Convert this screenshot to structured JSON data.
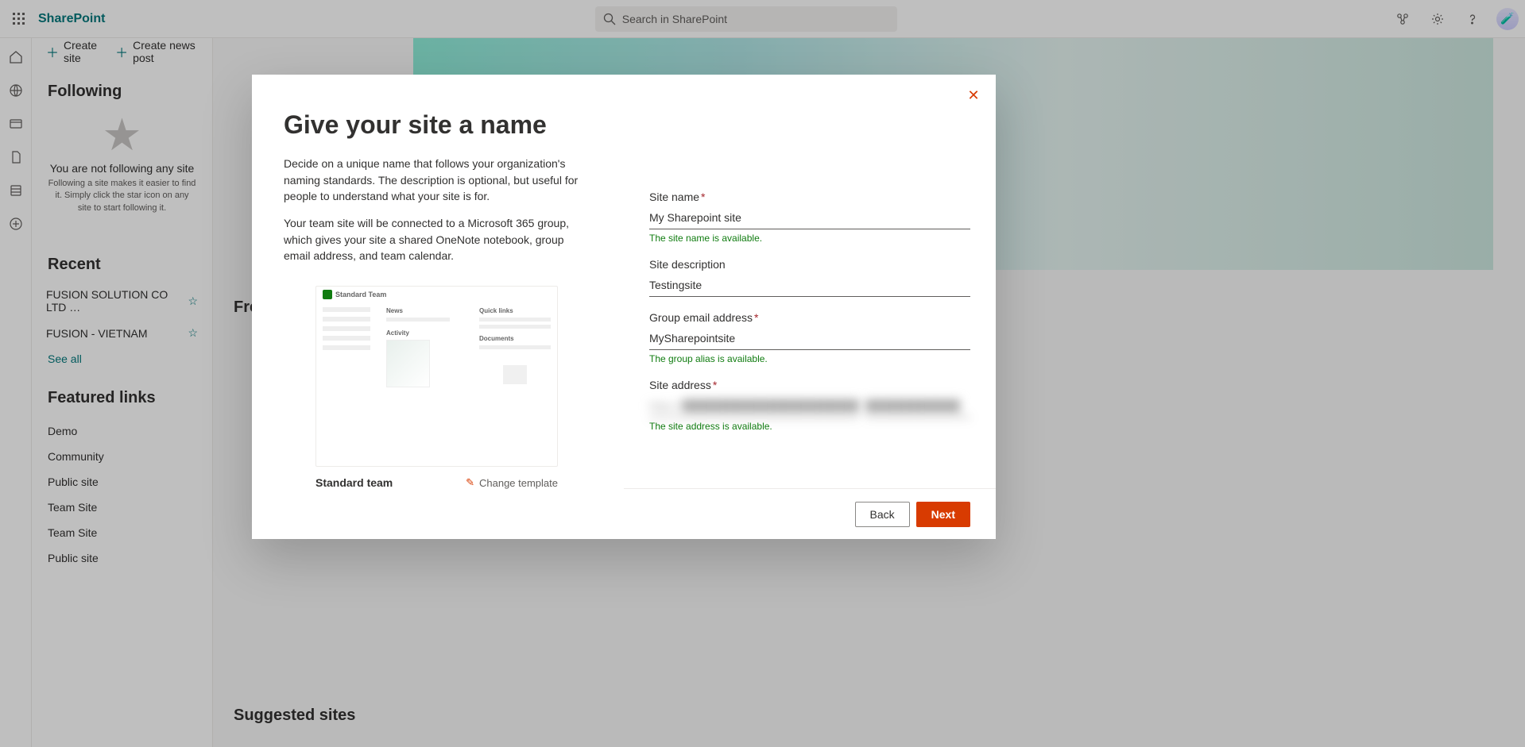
{
  "brand": "SharePoint",
  "search_placeholder": "Search in SharePoint",
  "cmd": {
    "create_site": "Create site",
    "create_news": "Create news post"
  },
  "sidebar": {
    "following_title": "Following",
    "following_empty_msg": "You are not following any site",
    "following_empty_sub": "Following a site makes it easier to find it. Simply click the star icon on any site to start following it.",
    "recent_title": "Recent",
    "recent_items": [
      "FUSION SOLUTION CO LTD …",
      "FUSION - VIETNAM"
    ],
    "see_all": "See all",
    "featured_title": "Featured links",
    "featured_items": [
      "Demo",
      "Community",
      "Public site",
      "Team Site",
      "Team Site",
      "Public site"
    ]
  },
  "page": {
    "frequent_title": "Frequent sites",
    "suggested_title": "Suggested sites"
  },
  "modal": {
    "title": "Give your site a name",
    "desc1": "Decide on a unique name that follows your organization's naming standards. The description is optional, but useful for people to understand what your site is for.",
    "desc2": "Your team site will be connected to a Microsoft 365 group, which gives your site a shared OneNote notebook, group email address, and team calendar.",
    "template_name": "Standard team",
    "change_template": "Change template",
    "fields": {
      "site_name": {
        "label": "Site name",
        "value": "My Sharepoint site",
        "validation": "The site name is available."
      },
      "site_desc": {
        "label": "Site description",
        "value": "Testingsite"
      },
      "group_email": {
        "label": "Group email address",
        "value": "MySharepointsite",
        "validation": "The group alias is available."
      },
      "site_addr": {
        "label": "Site address",
        "prefix": "https://████████████████████████████",
        "suffix": "████████████",
        "validation": "The site address is available."
      }
    },
    "back": "Back",
    "next": "Next"
  }
}
